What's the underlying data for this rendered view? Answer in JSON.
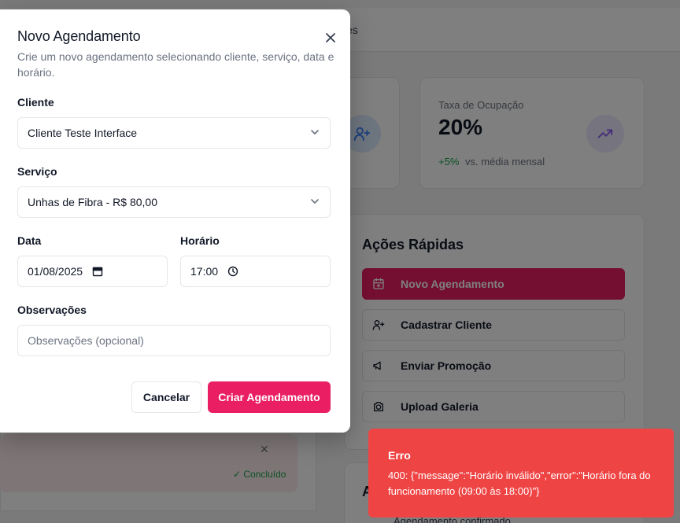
{
  "background": {
    "topbar_text": "es",
    "stats": {
      "occupancy_label": "Taxa de Ocupação",
      "occupancy_value": "20%",
      "occupancy_delta": "+5%",
      "occupancy_delta_note": "vs. média mensal"
    },
    "quick_actions": {
      "title": "Ações Rápidas",
      "items": [
        {
          "label": "Novo Agendamento",
          "icon": "calendar-plus-icon"
        },
        {
          "label": "Cadastrar Cliente",
          "icon": "user-plus-icon"
        },
        {
          "label": "Enviar Promoção",
          "icon": "megaphone-icon"
        },
        {
          "label": "Upload Galeria",
          "icon": "camera-icon"
        }
      ]
    },
    "appointment_status": "✓ Concluído",
    "recent_title": "A",
    "recent_item": "Agendamento confirmado"
  },
  "modal": {
    "title": "Novo Agendamento",
    "description": "Crie um novo agendamento selecionando cliente, serviço, data e horário.",
    "cliente_label": "Cliente",
    "cliente_value": "Cliente Teste Interface",
    "servico_label": "Serviço",
    "servico_value": "Unhas de Fibra - R$ 80,00",
    "data_label": "Data",
    "data_value": "01/08/2025",
    "horario_label": "Horário",
    "horario_value": "17:00",
    "observacoes_label": "Observações",
    "observacoes_placeholder": "Observações (opcional)",
    "cancel_label": "Cancelar",
    "submit_label": "Criar Agendamento"
  },
  "toast": {
    "title": "Erro",
    "message": "400: {\"message\":\"Horário inválido\",\"error\":\"Horário fora do funcionamento (09:00 às 18:00)\"}"
  },
  "colors": {
    "primary": "#e91e63",
    "error": "#ef4444",
    "success": "#16a34a"
  }
}
